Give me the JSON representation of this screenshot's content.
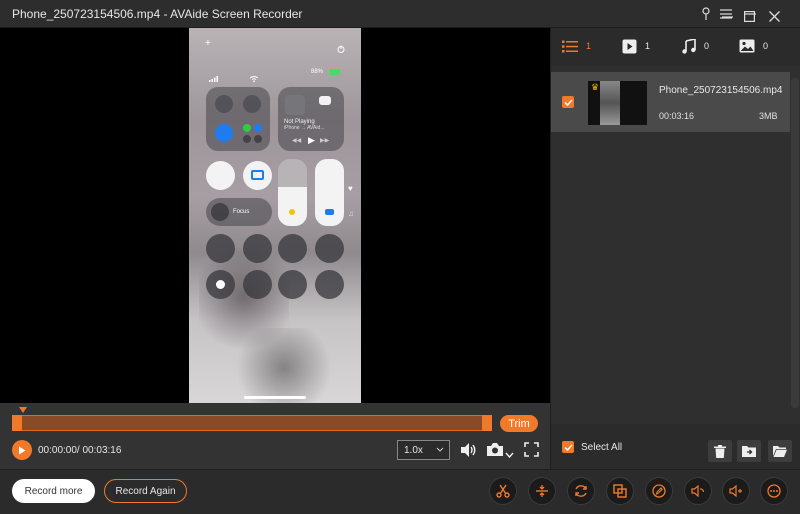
{
  "window": {
    "title": "Phone_250723154506.mp4 - AVAide Screen Recorder"
  },
  "phone_screen": {
    "battery": "88%",
    "now_playing": "Not Playing",
    "airplay_target": "iPhone → AVAid...",
    "focus_label": "Focus"
  },
  "timeline": {
    "time": "00:00:00/ 00:03:16",
    "trim_label": "Trim",
    "speed": "1.0x",
    "progress_fraction": 0.0
  },
  "tabs": [
    {
      "name": "list",
      "count": "1"
    },
    {
      "name": "video",
      "count": "1"
    },
    {
      "name": "audio",
      "count": "0"
    },
    {
      "name": "image",
      "count": "0"
    }
  ],
  "files": [
    {
      "name": "Phone_250723154506.mp4",
      "duration": "00:03:16",
      "size": "3MB",
      "checked": true
    }
  ],
  "select_all_label": "Select All",
  "buttons": {
    "record_more": "Record more",
    "record_again": "Record Again"
  },
  "colors": {
    "accent": "#f07a2a",
    "background": "#2b2b2b",
    "selected_row": "#4a4a4a"
  }
}
